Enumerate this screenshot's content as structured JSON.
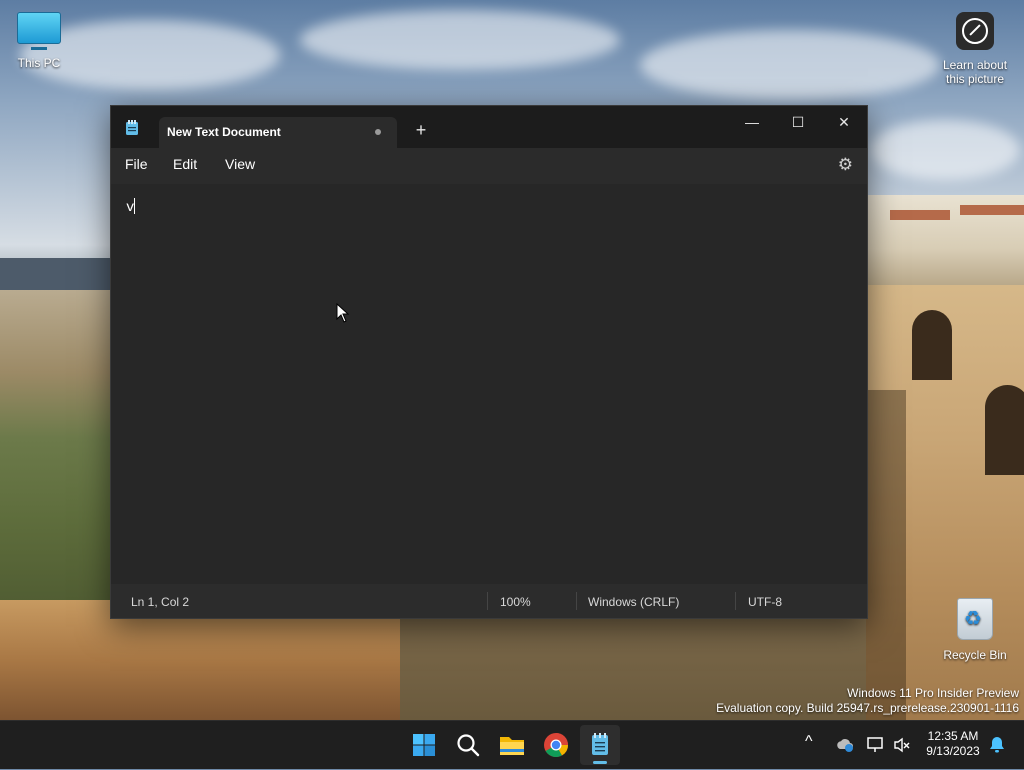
{
  "desktop": {
    "icons": [
      {
        "label": "This PC"
      },
      {
        "label": "Learn about this picture"
      },
      {
        "label": "Recycle Bin"
      }
    ],
    "watermark": {
      "line1": "Windows 11 Pro Insider Preview",
      "line2": "Evaluation copy. Build 25947.rs_prerelease.230901-1116"
    }
  },
  "notepad": {
    "tab_title": "New Text Document",
    "new_tab_label": "+",
    "window_controls": {
      "minimize": "—",
      "maximize": "☐",
      "close": "✕"
    },
    "menu": [
      "File",
      "Edit",
      "View"
    ],
    "editor_text": "v",
    "status": {
      "position": "Ln 1, Col 2",
      "zoom": "100%",
      "line_ending": "Windows (CRLF)",
      "encoding": "UTF-8"
    },
    "accent_color": "#62bde8"
  },
  "taskbar": {
    "apps": [
      {
        "icon": "windows-start-icon"
      },
      {
        "icon": "search-icon"
      },
      {
        "icon": "file-explorer-icon"
      },
      {
        "icon": "chrome-icon"
      },
      {
        "icon": "notepad-icon"
      }
    ],
    "tray": {
      "chevron": "^",
      "time": "12:35 AM",
      "date": "9/13/2023"
    }
  }
}
